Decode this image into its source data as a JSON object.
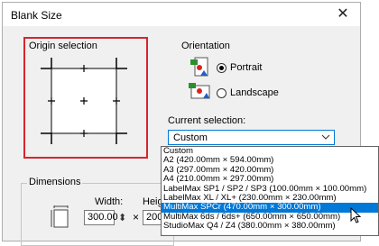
{
  "dialog": {
    "title": "Blank Size",
    "close_glyph": "✕"
  },
  "origin": {
    "group_label": "Origin selection"
  },
  "orientation": {
    "group_label": "Orientation",
    "portrait_label": "Portrait",
    "landscape_label": "Landscape",
    "selected": "Portrait"
  },
  "current_selection": {
    "label": "Current selection:",
    "value": "Custom",
    "options": [
      "Custom",
      "A2 (420.00mm × 594.00mm)",
      "A3 (297.00mm × 420.00mm)",
      "A4 (210.00mm × 297.00mm)",
      "LabelMax SP1 / SP2 / SP3 (100.00mm × 100.00mm)",
      "LabelMax XL / XL+ (230.00mm × 230.00mm)",
      "MultiMax SPCr (470.00mm × 300.00mm)",
      "MultiMax 6ds / 6ds+ (650.00mm × 650.00mm)",
      "StudioMax Q4 / Z4 (380.00mm × 380.00mm)"
    ],
    "highlighted_index": 6
  },
  "dimensions": {
    "group_label": "Dimensions",
    "width_label": "Width:",
    "height_label": "Heig",
    "width_value": "300.00",
    "height_value": "200",
    "times_glyph": "×",
    "spin_glyph": "⬍"
  },
  "colors": {
    "highlight_border": "#d6262d",
    "selection_bg": "#0078d7"
  }
}
